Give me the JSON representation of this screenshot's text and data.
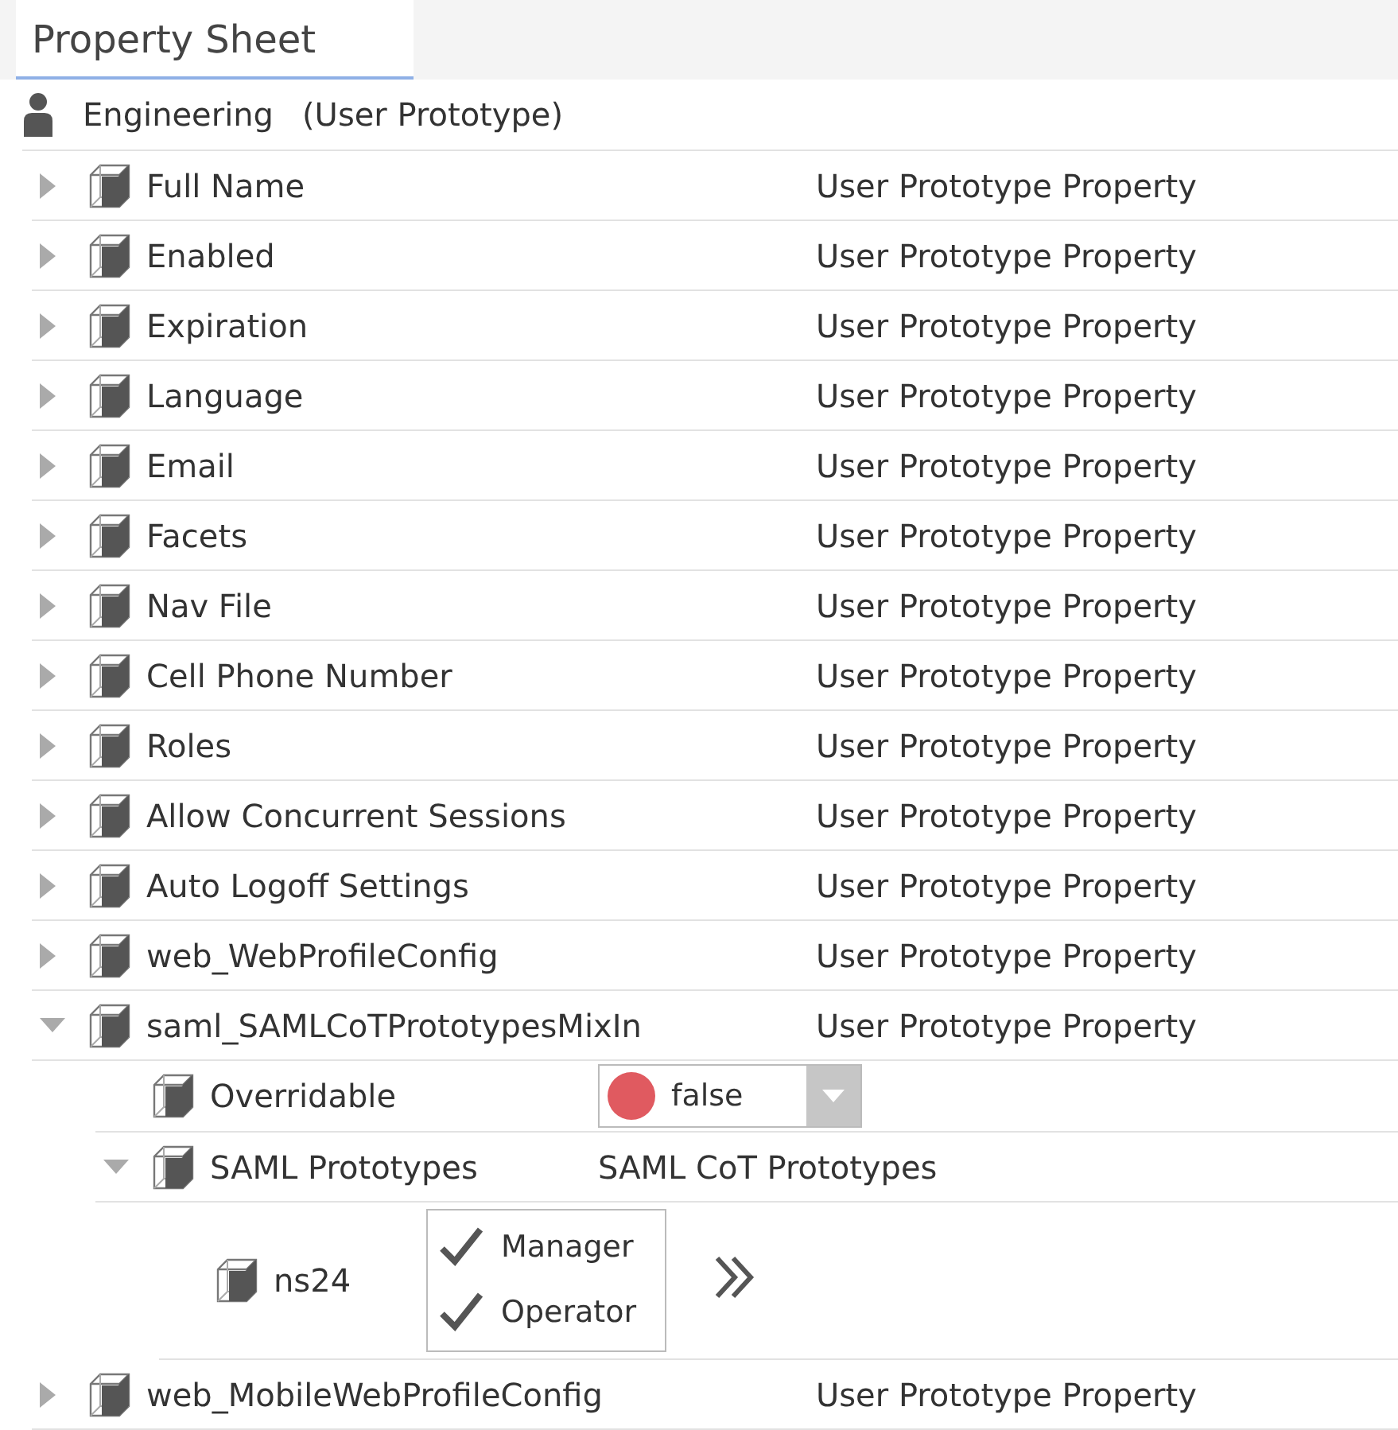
{
  "tab": {
    "label": "Property Sheet",
    "selected": true
  },
  "header": {
    "name": "Engineering",
    "type": "(User Prototype)"
  },
  "rows": [
    {
      "kind": "property",
      "name": "Full Name",
      "value": "User Prototype Property",
      "expanded": false
    },
    {
      "kind": "property",
      "name": "Enabled",
      "value": "User Prototype Property",
      "expanded": false
    },
    {
      "kind": "property",
      "name": "Expiration",
      "value": "User Prototype Property",
      "expanded": false
    },
    {
      "kind": "property",
      "name": "Language",
      "value": "User Prototype Property",
      "expanded": false
    },
    {
      "kind": "property",
      "name": "Email",
      "value": "User Prototype Property",
      "expanded": false
    },
    {
      "kind": "property",
      "name": "Facets",
      "value": "User Prototype Property",
      "expanded": false
    },
    {
      "kind": "property",
      "name": "Nav File",
      "value": "User Prototype Property",
      "expanded": false
    },
    {
      "kind": "property",
      "name": "Cell Phone Number",
      "value": "User Prototype Property",
      "expanded": false
    },
    {
      "kind": "property",
      "name": "Roles",
      "value": "User Prototype Property",
      "expanded": false
    },
    {
      "kind": "property",
      "name": "Allow Concurrent Sessions",
      "value": "User Prototype Property",
      "expanded": false
    },
    {
      "kind": "property",
      "name": "Auto Logoff Settings",
      "value": "User Prototype Property",
      "expanded": false
    },
    {
      "kind": "property",
      "name": "web_WebProfileConfig",
      "value": "User Prototype Property",
      "expanded": false
    },
    {
      "kind": "property",
      "name": "saml_SAMLCoTPrototypesMixIn",
      "value": "User Prototype Property",
      "expanded": true,
      "children": [
        {
          "kind": "dropdown",
          "name": "Overridable",
          "value": "false",
          "color": "#e05a60"
        },
        {
          "kind": "property",
          "name": "SAML Prototypes",
          "value": "SAML CoT Prototypes",
          "expanded": true,
          "children": [
            {
              "kind": "checklist",
              "name": "ns24",
              "options": [
                {
                  "label": "Manager",
                  "checked": true
                },
                {
                  "label": "Operator",
                  "checked": true
                }
              ]
            }
          ]
        }
      ]
    },
    {
      "kind": "property",
      "name": "web_MobileWebProfileConfig",
      "value": "User Prototype Property",
      "expanded": false
    }
  ]
}
